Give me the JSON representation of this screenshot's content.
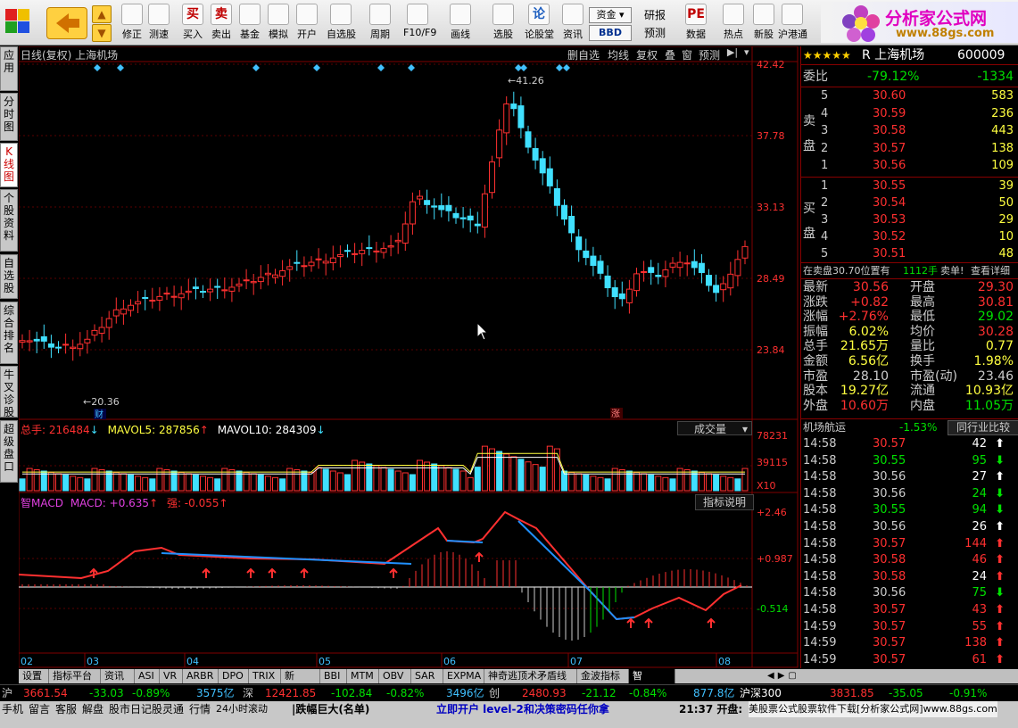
{
  "toolbar": {
    "items": [
      {
        "label": "修正",
        "icon": "undo-arrow-icon"
      },
      {
        "label": "测速",
        "icon": "gauge-icon"
      },
      {
        "label": "买入",
        "icon": "buy-icon",
        "glyph": "买"
      },
      {
        "label": "卖出",
        "icon": "sell-icon",
        "glyph": "卖"
      },
      {
        "label": "基金",
        "icon": "fund-icon"
      },
      {
        "label": "模拟",
        "icon": "hammer-icon"
      },
      {
        "label": "开户",
        "icon": "lock-icon"
      },
      {
        "label": "自选股",
        "icon": "star-icon"
      },
      {
        "label": "周期",
        "icon": "clock-icon"
      },
      {
        "label": "F10/F9",
        "icon": "f10-icon"
      },
      {
        "label": "画线",
        "icon": "pencil-icon"
      },
      {
        "label": "选股",
        "icon": "select-icon"
      },
      {
        "label": "论股堂",
        "icon": "discuss-icon",
        "glyph": "论"
      },
      {
        "label": "资讯",
        "icon": "news-icon"
      },
      {
        "label": "研报",
        "icon": "report-icon"
      },
      {
        "label": "预测",
        "icon": "forecast-icon"
      },
      {
        "label": "数据",
        "icon": "pe-icon",
        "glyph": "PE"
      },
      {
        "label": "热点",
        "icon": "hot-icon"
      },
      {
        "label": "新股",
        "icon": "new-stock-icon"
      },
      {
        "label": "沪港通",
        "icon": "hk-icon"
      }
    ],
    "fund_label": "资金",
    "bbd_label": "BBD",
    "logo_text": "分析家公式网",
    "logo_url": "www.88gs.com"
  },
  "left_tabs": [
    "应用",
    "分时图",
    "K线图",
    "个股资料",
    "自选股",
    "综合排名",
    "牛叉诊股",
    "超级盘口"
  ],
  "chart": {
    "header": "日线(复权) 上海机场",
    "right_buttons": [
      "删自选",
      "均线",
      "复权",
      "叠",
      "窗",
      "预测"
    ],
    "price_axis": [
      "42.42",
      "37.78",
      "33.13",
      "28.49",
      "23.84"
    ],
    "high_label": "41.26",
    "low_label": "20.36",
    "cai_label": "财",
    "zhang_label": "涨",
    "months": [
      "02",
      "03",
      "04",
      "05",
      "06",
      "07",
      "08"
    ],
    "vol_header": {
      "total": "总手: 216484",
      "mavol5": "MAVOL5: 287856",
      "mavol10": "MAVOL10: 284309"
    },
    "vol_button": "成交量",
    "vol_axis": [
      "78231",
      "39115",
      "X10"
    ],
    "macd_header": {
      "name": "智MACD",
      "macd": "MACD: +0.635",
      "strong": "强: -0.055"
    },
    "macd_button": "指标说明",
    "macd_axis": [
      "+2.46",
      "+0.987",
      "-0.514"
    ]
  },
  "quote": {
    "title": "R 上海机场",
    "code": "600009",
    "weibi_label": "委比",
    "weibi": "-79.12%",
    "weicha": "-1334",
    "sell_label": [
      "卖",
      "盘"
    ],
    "buy_label": [
      "买",
      "盘"
    ],
    "asks": [
      {
        "n": "5",
        "p": "30.60",
        "v": "583"
      },
      {
        "n": "4",
        "p": "30.59",
        "v": "236"
      },
      {
        "n": "3",
        "p": "30.58",
        "v": "443"
      },
      {
        "n": "2",
        "p": "30.57",
        "v": "138"
      },
      {
        "n": "1",
        "p": "30.56",
        "v": "109"
      }
    ],
    "bids": [
      {
        "n": "1",
        "p": "30.55",
        "v": "39"
      },
      {
        "n": "2",
        "p": "30.54",
        "v": "50"
      },
      {
        "n": "3",
        "p": "30.53",
        "v": "29"
      },
      {
        "n": "4",
        "p": "30.52",
        "v": "10"
      },
      {
        "n": "5",
        "p": "30.51",
        "v": "48"
      }
    ],
    "notice": {
      "a": "在卖盘30.70位置有",
      "b": "1112手",
      "c": "卖单!",
      "d": "查看详细"
    },
    "stats": [
      [
        "最新",
        "30.56",
        "开盘",
        "29.30"
      ],
      [
        "涨跌",
        "+0.82",
        "最高",
        "30.81"
      ],
      [
        "涨幅",
        "+2.76%",
        "最低",
        "29.02"
      ],
      [
        "振幅",
        "6.02%",
        "均价",
        "30.28"
      ],
      [
        "总手",
        "21.65万",
        "量比",
        "0.77"
      ],
      [
        "金额",
        "6.56亿",
        "换手",
        "1.98%"
      ],
      [
        "市盈",
        "28.10",
        "市盈(动)",
        "23.46"
      ],
      [
        "股本",
        "19.27亿",
        "流通",
        "10.93亿"
      ],
      [
        "外盘",
        "10.60万",
        "内盘",
        "11.05万"
      ]
    ],
    "sector": {
      "name": "机场航运",
      "pct": "-1.53%",
      "btn": "同行业比较"
    },
    "ticks": [
      {
        "t": "14:58",
        "p": "30.57",
        "v": "42",
        "d": "up"
      },
      {
        "t": "14:58",
        "p": "30.55",
        "v": "95",
        "d": "down"
      },
      {
        "t": "14:58",
        "p": "30.56",
        "v": "27",
        "d": "up"
      },
      {
        "t": "14:58",
        "p": "30.56",
        "v": "24",
        "d": "down"
      },
      {
        "t": "14:58",
        "p": "30.55",
        "v": "94",
        "d": "down"
      },
      {
        "t": "14:58",
        "p": "30.56",
        "v": "26",
        "d": "up"
      },
      {
        "t": "14:58",
        "p": "30.57",
        "v": "144",
        "d": "up"
      },
      {
        "t": "14:58",
        "p": "30.58",
        "v": "46",
        "d": "up"
      },
      {
        "t": "14:58",
        "p": "30.58",
        "v": "24",
        "d": "up"
      },
      {
        "t": "14:58",
        "p": "30.56",
        "v": "75",
        "d": "down"
      },
      {
        "t": "14:58",
        "p": "30.57",
        "v": "43",
        "d": "up"
      },
      {
        "t": "14:59",
        "p": "30.57",
        "v": "55",
        "d": "up"
      },
      {
        "t": "14:59",
        "p": "30.57",
        "v": "138",
        "d": "up"
      },
      {
        "t": "14:59",
        "p": "30.57",
        "v": "61",
        "d": "up"
      }
    ],
    "bottom_tabs": [
      "细",
      "诊",
      "分",
      "筹",
      "焰",
      "指",
      "财"
    ]
  },
  "bottom_tabs": [
    "设置",
    "指标平台",
    "资讯",
    "ASI",
    "VR",
    "ARBR",
    "DPO",
    "TRIX",
    "新DMA",
    "BBI",
    "MTM",
    "OBV",
    "SAR",
    "EXPMA",
    "神奇逃顶术矛盾线",
    "金波指标",
    "智MACD"
  ],
  "status1": {
    "sh_label": "沪",
    "sh_idx": "3661.54",
    "sh_chg": "-33.03",
    "sh_pct": "-0.89%",
    "sh_amt": "3575亿",
    "sz_label": "深",
    "sz_idx": "12421.85",
    "sz_chg": "-102.84",
    "sz_pct": "-0.82%",
    "sz_amt": "3496亿",
    "cy_label": "创",
    "cy_idx": "2480.93",
    "cy_chg": "-21.12",
    "cy_pct": "-0.84%",
    "cy_amt": "877.8亿",
    "hs_label": "沪深300",
    "hs_idx": "3831.85",
    "hs_chg": "-35.05",
    "hs_pct": "-0.91%"
  },
  "status2": {
    "items": [
      "手机",
      "留言",
      "客服",
      "解盘",
      "股市日记",
      "股灵通",
      "行情",
      "24小时滚动"
    ],
    "alert": "|跌幅巨大(名单)",
    "ad": "立即开户  level-2和决策密码任你拿",
    "time": "21:37 开盘:",
    "footer": "美股票公式股票软件下载[分析家公式网]www.88gs.com"
  }
}
